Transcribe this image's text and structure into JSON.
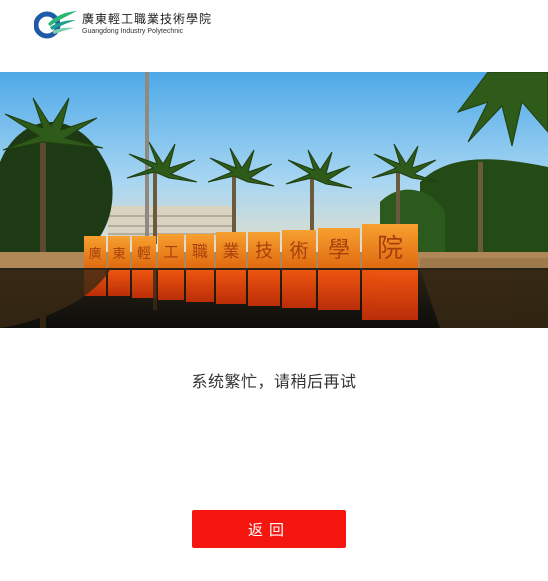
{
  "header": {
    "logo": {
      "name_cn": "廣東輕工職業技術學院",
      "name_en": "Guangdong Industry Polytechnic"
    }
  },
  "hero": {
    "monument_chars": [
      "廣",
      "東",
      "輕",
      "工",
      "職",
      "業",
      "技",
      "術",
      "學",
      "院"
    ]
  },
  "main": {
    "message": "系统繁忙，请稍后再试",
    "back_button_label": "返回"
  },
  "colors": {
    "accent": "#f5170f",
    "text": "#333333",
    "background": "#ffffff",
    "logo_blue": "#1e5aa8",
    "logo_green": "#2bb673"
  }
}
